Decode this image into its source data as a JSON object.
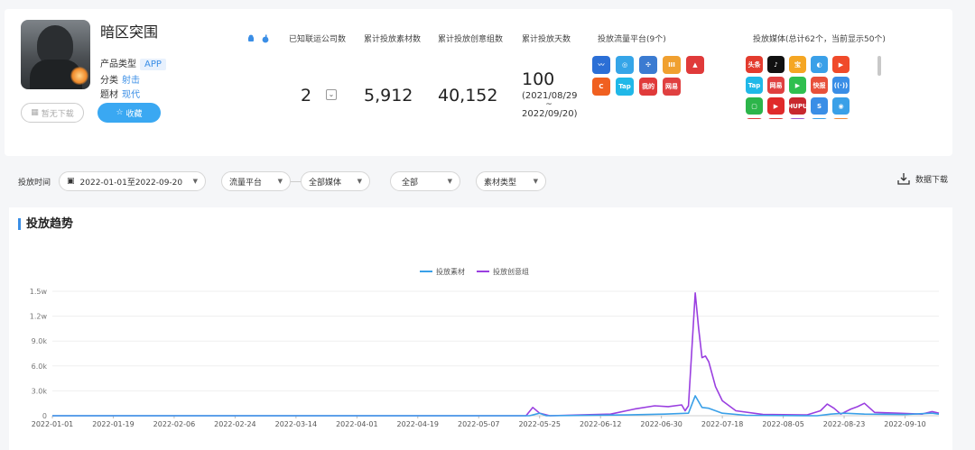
{
  "app": {
    "name": "暗区突围",
    "type_label": "产品类型",
    "type_value": "APP",
    "category_label": "分类",
    "category_value": "射击",
    "theme_label": "题材",
    "theme_value": "现代",
    "no_download_label": "暂无下载",
    "favorite_label": "收藏"
  },
  "stats": {
    "partner_label": "已知联运公司数",
    "partner_value": "2",
    "material_label": "累计投放素材数",
    "material_value": "5,912",
    "creative_label": "累计投放创意组数",
    "creative_value": "40,152",
    "days_label": "累计投放天数",
    "days_value": "100",
    "days_range_start": "(2021/08/29",
    "days_range_sep": "~",
    "days_range_end": "2022/09/20)",
    "platform_label": "投放流量平台(9个)",
    "media_label": "投放媒体(总计62个，当前显示50个)"
  },
  "platforms": [
    {
      "name": "platform-1",
      "color": "#2b6fd6",
      "text": "〰"
    },
    {
      "name": "platform-2",
      "color": "#35a5e8",
      "text": "◎"
    },
    {
      "name": "platform-3",
      "color": "#3b7bd1",
      "text": "✣"
    },
    {
      "name": "platform-4",
      "color": "#f0a030",
      "text": "III"
    },
    {
      "name": "platform-5",
      "color": "#e03a3a",
      "text": "▲"
    },
    {
      "name": "platform-6",
      "color": "#f06020",
      "text": "C"
    },
    {
      "name": "platform-7",
      "color": "#20b8e8",
      "text": "Tap"
    },
    {
      "name": "platform-8",
      "color": "#e03a3a",
      "text": "我的"
    },
    {
      "name": "platform-9",
      "color": "#e04040",
      "text": "网易"
    }
  ],
  "media": [
    {
      "name": "toutiao",
      "color": "#e33b2e",
      "text": "头条"
    },
    {
      "name": "douyin",
      "color": "#111111",
      "text": "♪"
    },
    {
      "name": "media-3",
      "color": "#f5a623",
      "text": "宝"
    },
    {
      "name": "media-4",
      "color": "#3aa0e8",
      "text": "◐"
    },
    {
      "name": "media-5",
      "color": "#f04a2a",
      "text": "▶"
    },
    {
      "name": "taptap",
      "color": "#20b8e8",
      "text": "Tap"
    },
    {
      "name": "netease",
      "color": "#e04040",
      "text": "网易"
    },
    {
      "name": "media-8",
      "color": "#2fbf4f",
      "text": "▶"
    },
    {
      "name": "kuaibao",
      "color": "#e8503a",
      "text": "快报"
    },
    {
      "name": "media-10",
      "color": "#3a8ee6",
      "text": "((·))"
    },
    {
      "name": "media-11",
      "color": "#2cb54a",
      "text": "▢"
    },
    {
      "name": "media-12",
      "color": "#e02a2a",
      "text": "▶"
    },
    {
      "name": "hupu",
      "color": "#c8282e",
      "text": "HUPU"
    },
    {
      "name": "media-14",
      "color": "#3a8ee6",
      "text": "S"
    },
    {
      "name": "media-15",
      "color": "#3aa0e8",
      "text": "◉"
    },
    {
      "name": "media-16",
      "color": "#e03a3a",
      "text": ""
    },
    {
      "name": "media-17",
      "color": "#e03a3a",
      "text": ""
    },
    {
      "name": "media-18",
      "color": "#9b59d0",
      "text": ""
    },
    {
      "name": "media-19",
      "color": "#3aa0e8",
      "text": ""
    },
    {
      "name": "media-20",
      "color": "#f08a3a",
      "text": ""
    }
  ],
  "filters": {
    "time_label": "投放时间",
    "date_range": "2022-01-01至2022-09-20",
    "platform": "流量平台",
    "media": "全部媒体",
    "all": "全部",
    "material_type": "素材类型",
    "download": "数据下载"
  },
  "chart_section_title": "投放趋势",
  "chart_data": {
    "type": "line",
    "x": [
      "2022-01-01",
      "2022-01-19",
      "2022-02-06",
      "2022-02-24",
      "2022-03-14",
      "2022-04-01",
      "2022-04-19",
      "2022-05-07",
      "2022-05-25",
      "2022-06-12",
      "2022-06-30",
      "2022-07-18",
      "2022-08-05",
      "2022-08-23",
      "2022-09-10"
    ],
    "x_start": "2022-01-01",
    "x_end": "2022-09-20",
    "ylim": [
      0,
      15000
    ],
    "y_ticks": [
      0,
      3000,
      6000,
      9000,
      12000,
      15000
    ],
    "y_tick_labels": [
      "0",
      "3.0k",
      "6.0k",
      "9.0k",
      "1.2w",
      "1.5w"
    ],
    "legend_position": "top-center",
    "series": [
      {
        "name": "投放素材",
        "color": "#3aa0e8",
        "points": [
          [
            "2022-01-01",
            0
          ],
          [
            "2022-05-22",
            0
          ],
          [
            "2022-05-25",
            300
          ],
          [
            "2022-05-27",
            0
          ],
          [
            "2022-06-20",
            100
          ],
          [
            "2022-07-01",
            200
          ],
          [
            "2022-07-08",
            300
          ],
          [
            "2022-07-10",
            2400
          ],
          [
            "2022-07-12",
            1000
          ],
          [
            "2022-07-14",
            900
          ],
          [
            "2022-07-18",
            300
          ],
          [
            "2022-07-25",
            50
          ],
          [
            "2022-08-15",
            0
          ],
          [
            "2022-08-19",
            200
          ],
          [
            "2022-08-23",
            300
          ],
          [
            "2022-08-29",
            200
          ],
          [
            "2022-09-10",
            150
          ],
          [
            "2022-09-18",
            300
          ],
          [
            "2022-09-20",
            200
          ]
        ]
      },
      {
        "name": "投放创意组",
        "color": "#9a3fe0",
        "points": [
          [
            "2022-01-01",
            0
          ],
          [
            "2022-05-21",
            0
          ],
          [
            "2022-05-23",
            1000
          ],
          [
            "2022-05-25",
            300
          ],
          [
            "2022-05-28",
            0
          ],
          [
            "2022-06-15",
            200
          ],
          [
            "2022-06-22",
            800
          ],
          [
            "2022-06-28",
            1200
          ],
          [
            "2022-07-02",
            1100
          ],
          [
            "2022-07-06",
            1300
          ],
          [
            "2022-07-07",
            600
          ],
          [
            "2022-07-08",
            1200
          ],
          [
            "2022-07-10",
            14800
          ],
          [
            "2022-07-11",
            10500
          ],
          [
            "2022-07-12",
            7000
          ],
          [
            "2022-07-13",
            7200
          ],
          [
            "2022-07-14",
            6500
          ],
          [
            "2022-07-16",
            3500
          ],
          [
            "2022-07-18",
            1800
          ],
          [
            "2022-07-22",
            600
          ],
          [
            "2022-07-30",
            150
          ],
          [
            "2022-08-12",
            100
          ],
          [
            "2022-08-16",
            600
          ],
          [
            "2022-08-18",
            1400
          ],
          [
            "2022-08-20",
            900
          ],
          [
            "2022-08-22",
            200
          ],
          [
            "2022-08-25",
            800
          ],
          [
            "2022-08-27",
            1100
          ],
          [
            "2022-08-29",
            1500
          ],
          [
            "2022-09-01",
            400
          ],
          [
            "2022-09-08",
            300
          ],
          [
            "2022-09-15",
            200
          ],
          [
            "2022-09-18",
            500
          ],
          [
            "2022-09-20",
            300
          ]
        ]
      }
    ]
  }
}
